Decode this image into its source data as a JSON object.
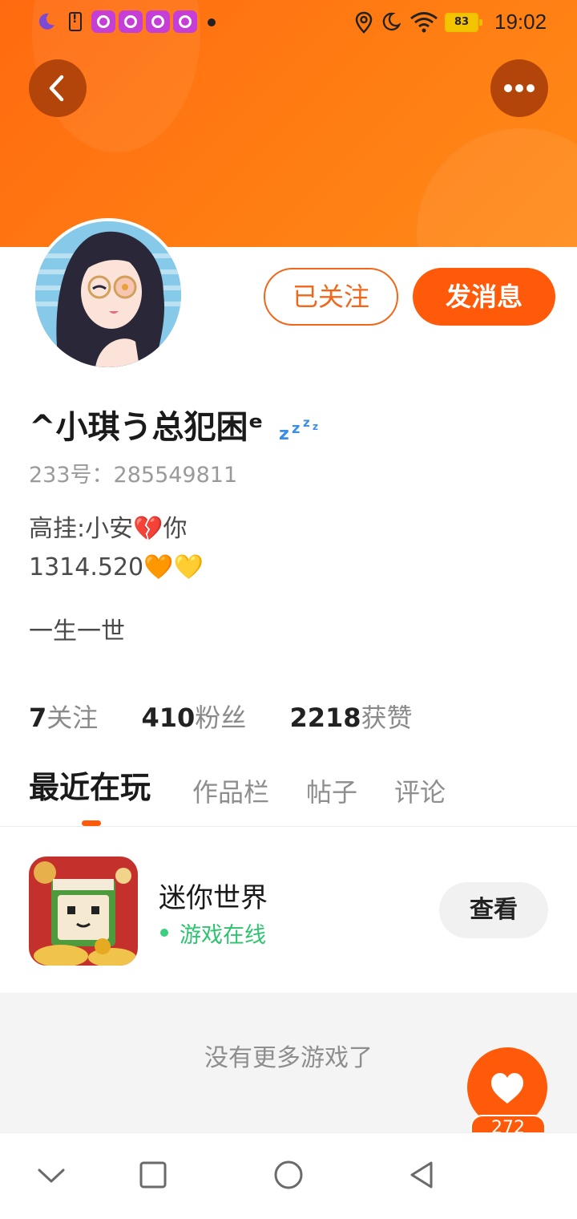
{
  "status_bar": {
    "time": "19:02",
    "battery_level": "83",
    "icons": [
      "moon-icon",
      "battery-alert-icon",
      "app-notification-icon",
      "app-notification-icon",
      "app-notification-icon",
      "app-notification-icon",
      "dot-icon",
      "location-icon",
      "do-not-disturb-icon",
      "wifi-icon",
      "battery-icon"
    ]
  },
  "header": {
    "back_icon": "chevron-left-icon",
    "more_icon": "more-horizontal-icon",
    "accent_color": "#ff6a10"
  },
  "profile": {
    "avatar_icon": "user-avatar",
    "nickname": "^小琪う总犯困ᵉ",
    "nickname_emoji": "zzz-icon",
    "user_id": "233号：285549811",
    "bio": [
      "高挂:小安💔你",
      "1314.520🧡💛",
      "一生一世"
    ]
  },
  "actions": {
    "follow_label": "已关注",
    "message_label": "发消息"
  },
  "stats": [
    {
      "value": "7",
      "label": "关注"
    },
    {
      "value": "410",
      "label": "粉丝"
    },
    {
      "value": "2218",
      "label": "获赞"
    }
  ],
  "tabs": [
    {
      "label": "最近在玩",
      "active": true
    },
    {
      "label": "作品栏",
      "active": false
    },
    {
      "label": "帖子",
      "active": false
    },
    {
      "label": "评论",
      "active": false
    }
  ],
  "games": [
    {
      "name": "迷你世界",
      "status": "游戏在线",
      "button": "查看"
    }
  ],
  "empty_state": "没有更多游戏了",
  "like": {
    "count": "272",
    "icon": "heart-icon"
  },
  "nav": {
    "icons": [
      "chevron-down-icon",
      "square-icon",
      "circle-icon",
      "triangle-back-icon"
    ]
  },
  "colors": {
    "primary": "#ff5a0a",
    "online": "#2ec46f"
  }
}
